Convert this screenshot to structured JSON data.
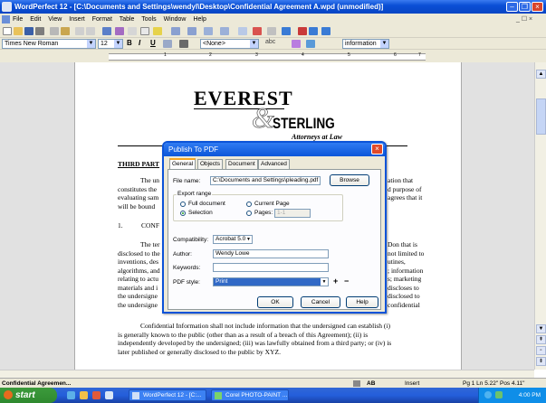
{
  "window": {
    "title": "WordPerfect 12 - [C:\\Documents and Settings\\wendyl\\Desktop\\Confidential Agreement A.wpd (unmodified)]"
  },
  "menu": [
    "File",
    "Edit",
    "View",
    "Insert",
    "Format",
    "Table",
    "Tools",
    "Window",
    "Help"
  ],
  "property_bar": {
    "font": "Times New Roman",
    "size": "12",
    "bold": "B",
    "italic": "I",
    "underline": "U",
    "style": "<None>",
    "abc": "abc",
    "info": "information"
  },
  "ruler": {
    "numbers": [
      "1",
      "2",
      "3",
      "4",
      "5",
      "6",
      "7"
    ]
  },
  "logo": {
    "line1": "EVEREST",
    "amp": "&",
    "line2": "STERLING",
    "tag": "Attorneys at Law"
  },
  "doc": {
    "heading": "THIRD PART",
    "p1_lines": [
      "The un",
      "constitutes the",
      "evaluating sam",
      "will be bound"
    ],
    "p1_right": [
      "ation that",
      "d purpose of",
      "agrees that it"
    ],
    "sec_num": "1.",
    "sec_title": "CONF",
    "p2_lines": [
      "The ter",
      "disclosed to the",
      "inventions, des",
      "algorithms, and",
      "relating to actu",
      "materials and i",
      "the undersigne",
      "the undersigne"
    ],
    "p2_right": [
      "Don that is",
      "not limited to",
      "utines,",
      "; information",
      "s; marketing",
      "discloses to",
      "disclosed to",
      "confidential"
    ],
    "p3_lines": [
      "Confidential Information shall not include information that the undersigned can establish (i)",
      "is generally known to the public (other than as a result of a breach of this Agreement); (ii) is",
      "independently developed by the undersigned; (iii) was lawfully obtained from a third party; or (iv) is",
      "later published or generally disclosed to the public by XYZ."
    ]
  },
  "dialog": {
    "title": "Publish To PDF",
    "tabs": [
      "General",
      "Objects",
      "Document",
      "Advanced"
    ],
    "file_name_label": "File name:",
    "file_name_value": "C:\\Documents and Settings\\pleading.pdf",
    "browse": "Browse",
    "export_range": "Export range",
    "full_document": "Full document",
    "current_page": "Current Page",
    "selection": "Selection",
    "pages_label": "Pages:",
    "pages_value": "1-1",
    "compat_label": "Compatibility:",
    "compat_value": "Acrobat 5.0",
    "author_label": "Author:",
    "author_value": "Wendy Lowe",
    "keywords_label": "Keywords:",
    "keywords_value": "",
    "pdf_style_label": "PDF style:",
    "pdf_style_value": "Print",
    "plus": "+",
    "minus": "−",
    "ok": "OK",
    "cancel": "Cancel",
    "help": "Help"
  },
  "status": {
    "doc": "Confidential Agreemen...",
    "ab": "AB",
    "insert": "Insert",
    "pos": "Pg 1 Ln 5.22\" Pos 4.11\""
  },
  "taskbar": {
    "start": "start",
    "task1": "WordPerfect 12 - [C:...",
    "task2": "Corel PHOTO-PAINT ...",
    "clock": "4:00 PM"
  },
  "colors": {
    "title_blue": "#0a4fd6",
    "selection_blue": "#3169c6",
    "taskbar_blue": "#245edb",
    "start_green": "#3c9a3c"
  }
}
